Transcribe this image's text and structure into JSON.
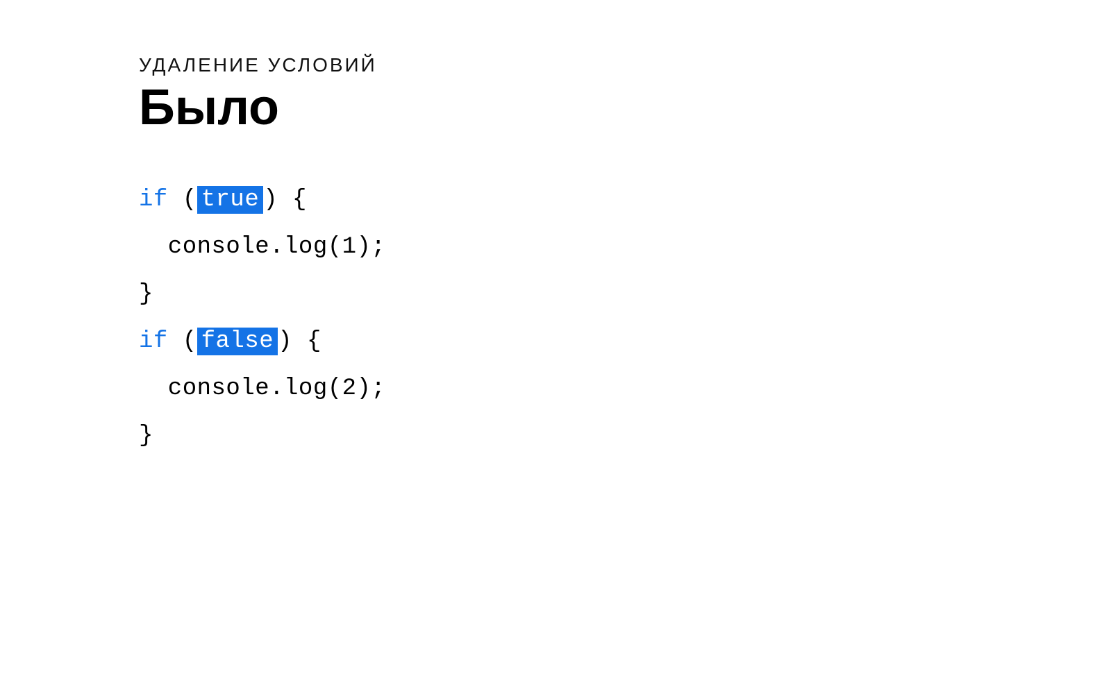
{
  "eyebrow": "УДАЛЕНИЕ УСЛОВИЙ",
  "title": "Было",
  "code": {
    "kw_if": "if",
    "open_paren": " (",
    "close_paren": ") {",
    "close_brace": "}",
    "true_token": "true",
    "false_token": "false",
    "body1": "  console.log(1);",
    "body2": "  console.log(2);"
  }
}
